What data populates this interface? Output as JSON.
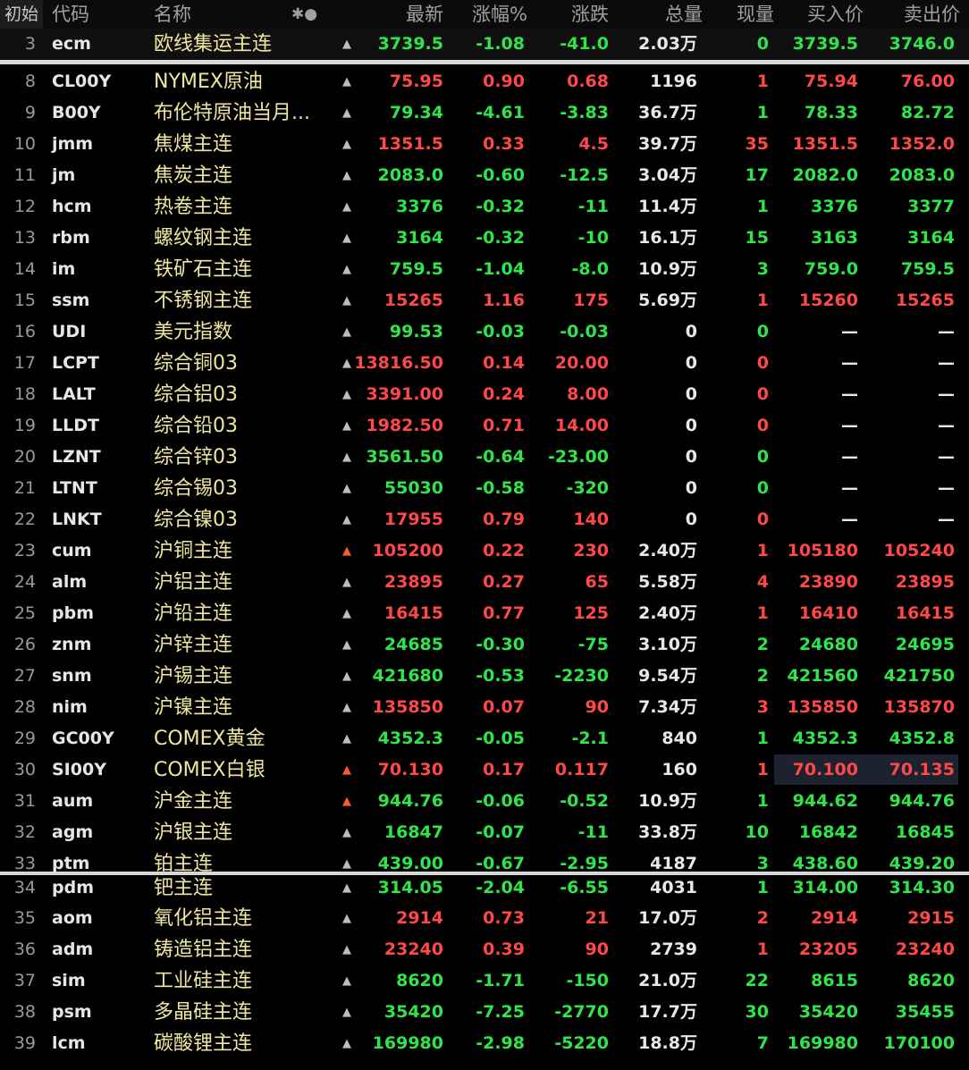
{
  "header": {
    "init": "初始",
    "code": "代码",
    "name": "名称",
    "extra": "✱●",
    "last": "最新",
    "pct": "涨幅%",
    "chg": "涨跌",
    "vol": "总量",
    "cur": "现量",
    "bid": "买入价",
    "ask": "卖出价"
  },
  "colors": {
    "up": "#ff4848",
    "down": "#2ee54a",
    "name": "#f0e6a0",
    "bell_active": "#ff5a28"
  },
  "rows": [
    {
      "num": "3",
      "code": "ecm",
      "name": "欧线集运主连",
      "bell": "bell-icon",
      "last": "3739.5",
      "pct": "-1.08",
      "chg": "-41.0",
      "vol": "2.03万",
      "cur": "0",
      "bid": "3739.5",
      "ask": "3746.0"
    },
    {
      "num": "8",
      "code": "CL00Y",
      "name": "NYMEX原油",
      "bell": "bell-icon",
      "last": "75.95",
      "pct": "0.90",
      "chg": "0.68",
      "vol": "1196",
      "cur": "1",
      "bid": "75.94",
      "ask": "76.00"
    },
    {
      "num": "9",
      "code": "B00Y",
      "name": "布伦特原油当月...",
      "bell": "bell-icon",
      "last": "79.34",
      "pct": "-4.61",
      "chg": "-3.83",
      "vol": "36.7万",
      "cur": "1",
      "bid": "78.33",
      "ask": "82.72"
    },
    {
      "num": "10",
      "code": "jmm",
      "name": "焦煤主连",
      "bell": "bell-icon",
      "last": "1351.5",
      "pct": "0.33",
      "chg": "4.5",
      "vol": "39.7万",
      "cur": "35",
      "bid": "1351.5",
      "ask": "1352.0"
    },
    {
      "num": "11",
      "code": "jm",
      "name": "焦炭主连",
      "bell": "bell-icon",
      "last": "2083.0",
      "pct": "-0.60",
      "chg": "-12.5",
      "vol": "3.04万",
      "cur": "17",
      "bid": "2082.0",
      "ask": "2083.0"
    },
    {
      "num": "12",
      "code": "hcm",
      "name": "热卷主连",
      "bell": "bell-icon",
      "last": "3376",
      "pct": "-0.32",
      "chg": "-11",
      "vol": "11.4万",
      "cur": "1",
      "bid": "3376",
      "ask": "3377"
    },
    {
      "num": "13",
      "code": "rbm",
      "name": "螺纹钢主连",
      "bell": "bell-icon",
      "last": "3164",
      "pct": "-0.32",
      "chg": "-10",
      "vol": "16.1万",
      "cur": "15",
      "bid": "3163",
      "ask": "3164"
    },
    {
      "num": "14",
      "code": "im",
      "name": "铁矿石主连",
      "bell": "bell-icon",
      "last": "759.5",
      "pct": "-1.04",
      "chg": "-8.0",
      "vol": "10.9万",
      "cur": "3",
      "bid": "759.0",
      "ask": "759.5"
    },
    {
      "num": "15",
      "code": "ssm",
      "name": "不锈钢主连",
      "bell": "bell-icon",
      "last": "15265",
      "pct": "1.16",
      "chg": "175",
      "vol": "5.69万",
      "cur": "1",
      "bid": "15260",
      "ask": "15265"
    },
    {
      "num": "16",
      "code": "UDI",
      "name": "美元指数",
      "bell": "bell-icon",
      "last": "99.53",
      "pct": "-0.03",
      "chg": "-0.03",
      "vol": "0",
      "cur": "0",
      "bid": "—",
      "ask": "—"
    },
    {
      "num": "17",
      "code": "LCPT",
      "name": "综合铜03",
      "bell": "bell-icon",
      "last": "13816.50",
      "pct": "0.14",
      "chg": "20.00",
      "vol": "0",
      "cur": "0",
      "bid": "—",
      "ask": "—"
    },
    {
      "num": "18",
      "code": "LALT",
      "name": "综合铝03",
      "bell": "bell-icon",
      "last": "3391.00",
      "pct": "0.24",
      "chg": "8.00",
      "vol": "0",
      "cur": "0",
      "bid": "—",
      "ask": "—"
    },
    {
      "num": "19",
      "code": "LLDT",
      "name": "综合铅03",
      "bell": "bell-icon",
      "last": "1982.50",
      "pct": "0.71",
      "chg": "14.00",
      "vol": "0",
      "cur": "0",
      "bid": "—",
      "ask": "—"
    },
    {
      "num": "20",
      "code": "LZNT",
      "name": "综合锌03",
      "bell": "bell-icon",
      "last": "3561.50",
      "pct": "-0.64",
      "chg": "-23.00",
      "vol": "0",
      "cur": "0",
      "bid": "—",
      "ask": "—"
    },
    {
      "num": "21",
      "code": "LTNT",
      "name": "综合锡03",
      "bell": "bell-icon",
      "last": "55030",
      "pct": "-0.58",
      "chg": "-320",
      "vol": "0",
      "cur": "0",
      "bid": "—",
      "ask": "—"
    },
    {
      "num": "22",
      "code": "LNKT",
      "name": "综合镍03",
      "bell": "bell-icon",
      "last": "17955",
      "pct": "0.79",
      "chg": "140",
      "vol": "0",
      "cur": "0",
      "bid": "—",
      "ask": "—"
    },
    {
      "num": "23",
      "code": "cum",
      "name": "沪铜主连",
      "bell": "bell-active-icon",
      "last": "105200",
      "pct": "0.22",
      "chg": "230",
      "vol": "2.40万",
      "cur": "1",
      "bid": "105180",
      "ask": "105240"
    },
    {
      "num": "24",
      "code": "alm",
      "name": "沪铝主连",
      "bell": "bell-icon",
      "last": "23895",
      "pct": "0.27",
      "chg": "65",
      "vol": "5.58万",
      "cur": "4",
      "bid": "23890",
      "ask": "23895"
    },
    {
      "num": "25",
      "code": "pbm",
      "name": "沪铅主连",
      "bell": "bell-icon",
      "last": "16415",
      "pct": "0.77",
      "chg": "125",
      "vol": "2.40万",
      "cur": "1",
      "bid": "16410",
      "ask": "16415"
    },
    {
      "num": "26",
      "code": "znm",
      "name": "沪锌主连",
      "bell": "bell-icon",
      "last": "24685",
      "pct": "-0.30",
      "chg": "-75",
      "vol": "3.10万",
      "cur": "2",
      "bid": "24680",
      "ask": "24695"
    },
    {
      "num": "27",
      "code": "snm",
      "name": "沪锡主连",
      "bell": "bell-icon",
      "last": "421680",
      "pct": "-0.53",
      "chg": "-2230",
      "vol": "9.54万",
      "cur": "2",
      "bid": "421560",
      "ask": "421750"
    },
    {
      "num": "28",
      "code": "nim",
      "name": "沪镍主连",
      "bell": "bell-icon",
      "last": "135850",
      "pct": "0.07",
      "chg": "90",
      "vol": "7.34万",
      "cur": "3",
      "bid": "135850",
      "ask": "135870"
    },
    {
      "num": "29",
      "code": "GC00Y",
      "name": "COMEX黄金",
      "bell": "bell-icon",
      "last": "4352.3",
      "pct": "-0.05",
      "chg": "-2.1",
      "vol": "840",
      "cur": "1",
      "bid": "4352.3",
      "ask": "4352.8"
    },
    {
      "num": "30",
      "code": "SI00Y",
      "name": "COMEX白银",
      "bell": "bell-active-icon",
      "last": "70.130",
      "pct": "0.17",
      "chg": "0.117",
      "vol": "160",
      "cur": "1",
      "bid": "70.100",
      "ask": "70.135"
    },
    {
      "num": "31",
      "code": "aum",
      "name": "沪金主连",
      "bell": "bell-active-icon",
      "last": "944.76",
      "pct": "-0.06",
      "chg": "-0.52",
      "vol": "10.9万",
      "cur": "1",
      "bid": "944.62",
      "ask": "944.76"
    },
    {
      "num": "32",
      "code": "agm",
      "name": "沪银主连",
      "bell": "bell-icon",
      "last": "16847",
      "pct": "-0.07",
      "chg": "-11",
      "vol": "33.8万",
      "cur": "10",
      "bid": "16842",
      "ask": "16845"
    },
    {
      "num": "33",
      "code": "ptm",
      "name": "铂主连",
      "bell": "bell-icon",
      "last": "439.00",
      "pct": "-0.67",
      "chg": "-2.95",
      "vol": "4187",
      "cur": "3",
      "bid": "438.60",
      "ask": "439.20"
    },
    {
      "num": "34",
      "code": "pdm",
      "name": "钯主连",
      "bell": "bell-icon",
      "last": "314.05",
      "pct": "-2.04",
      "chg": "-6.55",
      "vol": "4031",
      "cur": "1",
      "bid": "314.00",
      "ask": "314.30"
    },
    {
      "num": "35",
      "code": "aom",
      "name": "氧化铝主连",
      "bell": "bell-icon",
      "last": "2914",
      "pct": "0.73",
      "chg": "21",
      "vol": "17.0万",
      "cur": "2",
      "bid": "2914",
      "ask": "2915"
    },
    {
      "num": "36",
      "code": "adm",
      "name": "铸造铝主连",
      "bell": "bell-icon",
      "last": "23240",
      "pct": "0.39",
      "chg": "90",
      "vol": "2739",
      "cur": "1",
      "bid": "23205",
      "ask": "23240"
    },
    {
      "num": "37",
      "code": "sim",
      "name": "工业硅主连",
      "bell": "bell-icon",
      "last": "8620",
      "pct": "-1.71",
      "chg": "-150",
      "vol": "21.0万",
      "cur": "22",
      "bid": "8615",
      "ask": "8620"
    },
    {
      "num": "38",
      "code": "psm",
      "name": "多晶硅主连",
      "bell": "bell-icon",
      "last": "35420",
      "pct": "-7.25",
      "chg": "-2770",
      "vol": "17.7万",
      "cur": "30",
      "bid": "35420",
      "ask": "35455"
    },
    {
      "num": "39",
      "code": "lcm",
      "name": "碳酸锂主连",
      "bell": "bell-icon",
      "last": "169980",
      "pct": "-2.98",
      "chg": "-5220",
      "vol": "18.8万",
      "cur": "7",
      "bid": "169980",
      "ask": "170100"
    }
  ]
}
